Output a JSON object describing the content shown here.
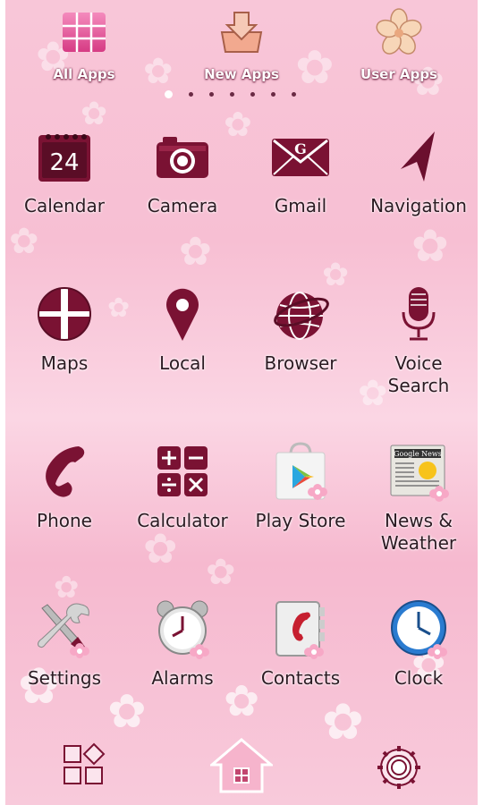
{
  "colors": {
    "icon_primary": "#6b0f2e",
    "background": "#f8c6d8",
    "label_text": "#2b1a22"
  },
  "top_bar": {
    "items": [
      {
        "label": "All Apps",
        "icon": "grid-tiles-icon"
      },
      {
        "label": "New Apps",
        "icon": "download-tray-icon"
      },
      {
        "label": "User Apps",
        "icon": "sakura-flower-icon"
      }
    ]
  },
  "pager": {
    "pages": 7,
    "current": 1
  },
  "apps": [
    {
      "label": "Calendar",
      "icon": "calendar-icon",
      "badge": "24"
    },
    {
      "label": "Camera",
      "icon": "camera-icon"
    },
    {
      "label": "Gmail",
      "icon": "gmail-envelope-icon",
      "badge": "G"
    },
    {
      "label": "Navigation",
      "icon": "navigation-arrow-icon"
    },
    {
      "label": "Maps",
      "icon": "maps-icon"
    },
    {
      "label": "Local",
      "icon": "location-pin-icon"
    },
    {
      "label": "Browser",
      "icon": "globe-icon"
    },
    {
      "label": "Voice Search",
      "icon": "microphone-icon"
    },
    {
      "label": "Phone",
      "icon": "phone-handset-icon"
    },
    {
      "label": "Calculator",
      "icon": "calculator-icon"
    },
    {
      "label": "Play Store",
      "icon": "play-store-bag-icon"
    },
    {
      "label": "News & Weather",
      "icon": "news-weather-icon",
      "badge": "Google News"
    },
    {
      "label": "Settings",
      "icon": "tools-icon"
    },
    {
      "label": "Alarms",
      "icon": "alarm-clock-icon"
    },
    {
      "label": "Contacts",
      "icon": "contacts-book-icon"
    },
    {
      "label": "Clock",
      "icon": "clock-icon"
    }
  ],
  "dock": [
    {
      "name": "app-drawer",
      "icon": "app-drawer-icon"
    },
    {
      "name": "home",
      "icon": "home-icon"
    },
    {
      "name": "settings",
      "icon": "gear-icon"
    }
  ]
}
